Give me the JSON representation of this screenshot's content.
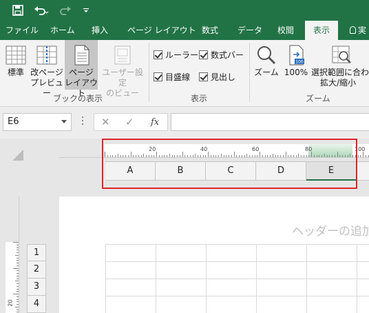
{
  "quick_access": {
    "save_icon": "save-icon",
    "undo_icon": "undo-icon",
    "redo_icon": "redo-icon",
    "customize_icon": "customize-quick-access-icon"
  },
  "tabs": [
    {
      "label": "ファイル"
    },
    {
      "label": "ホーム"
    },
    {
      "label": "挿入"
    },
    {
      "label": "ページ レイアウト"
    },
    {
      "label": "数式"
    },
    {
      "label": "データ"
    },
    {
      "label": "校閲"
    },
    {
      "label": "表示",
      "active": true
    },
    {
      "label": "実"
    }
  ],
  "ribbon": {
    "views": [
      {
        "label1": "標準",
        "label2": ""
      },
      {
        "label1": "改ページ",
        "label2": "プレビュー"
      },
      {
        "label1": "ページ",
        "label2": "レイアウト",
        "active": true
      },
      {
        "label1": "ユーザー設定",
        "label2": "のビュー",
        "disabled": true
      }
    ],
    "views_group_label": "ブックの表示",
    "show_checks": [
      {
        "label": "ルーラー",
        "checked": true
      },
      {
        "label": "数式バー",
        "checked": true
      },
      {
        "label": "目盛線",
        "checked": true
      },
      {
        "label": "見出し",
        "checked": true
      }
    ],
    "show_group_label": "表示",
    "zoom_buttons": [
      {
        "label1": "ズーム",
        "label2": ""
      },
      {
        "label1": "100%",
        "label2": ""
      },
      {
        "label1": "選択範囲に合わせて",
        "label2": "拡大/縮小"
      }
    ],
    "zoom_group_label": "ズーム"
  },
  "formula_bar": {
    "name_box": "E6",
    "cancel": "✕",
    "enter": "✓",
    "fx": "fx",
    "formula": ""
  },
  "ruler": {
    "labels": [
      "20",
      "40",
      "60",
      "80",
      "100"
    ]
  },
  "columns": [
    "A",
    "B",
    "C",
    "D",
    "E"
  ],
  "selected_column": "E",
  "rows": [
    "1",
    "2",
    "3",
    "4"
  ],
  "vertical_ruler_label": "20",
  "page": {
    "header_hint": "ヘッダーの追加"
  },
  "colors": {
    "accent": "#217346",
    "highlight_box": "#e0242b"
  }
}
